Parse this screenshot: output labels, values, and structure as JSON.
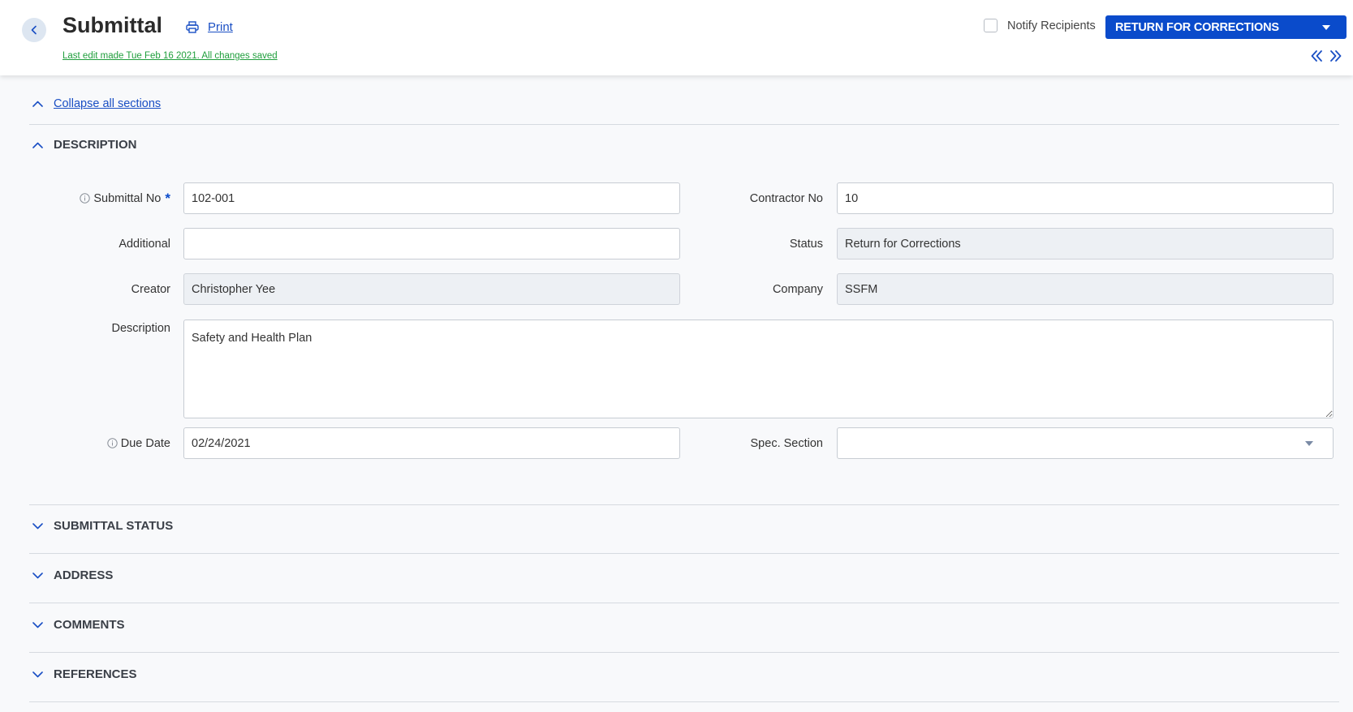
{
  "header": {
    "title": "Submittal",
    "print_label": "Print",
    "last_edit": "Last edit made Tue Feb 16 2021. All changes saved",
    "notify_label": "Notify Recipients",
    "action_label": "RETURN FOR CORRECTIONS"
  },
  "collapse_all_label": "Collapse all sections",
  "description_section": {
    "title": "DESCRIPTION",
    "fields": {
      "submittal_no": {
        "label": "Submittal No",
        "value": "102-001"
      },
      "contractor_no": {
        "label": "Contractor No",
        "value": "10"
      },
      "additional": {
        "label": "Additional",
        "value": ""
      },
      "status": {
        "label": "Status",
        "value": "Return for Corrections"
      },
      "creator": {
        "label": "Creator",
        "value": "Christopher Yee"
      },
      "company": {
        "label": "Company",
        "value": "SSFM"
      },
      "description": {
        "label": "Description",
        "value": "Safety and Health Plan"
      },
      "due_date": {
        "label": "Due Date",
        "value": "02/24/2021"
      },
      "spec_section": {
        "label": "Spec. Section",
        "value": ""
      }
    }
  },
  "collapsed_sections": [
    {
      "title": "SUBMITTAL STATUS"
    },
    {
      "title": "ADDRESS"
    },
    {
      "title": "COMMENTS"
    },
    {
      "title": "REFERENCES"
    }
  ],
  "colors": {
    "accent": "#0a4bcb",
    "link": "#1a4fc4",
    "saved_green": "#1f9e3c",
    "readonly_bg": "#edf0f4"
  }
}
